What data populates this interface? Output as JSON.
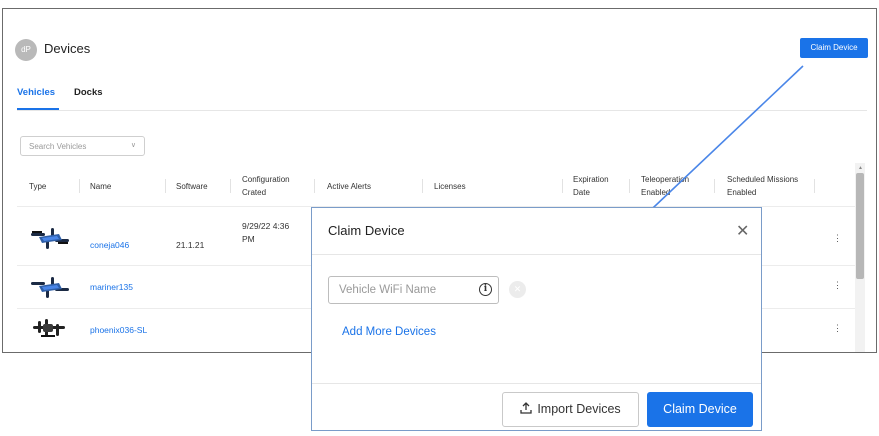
{
  "header": {
    "logo_text": "dP",
    "title": "Devices",
    "claim_button": "Claim Device"
  },
  "tabs": [
    {
      "label": "Vehicles",
      "active": true
    },
    {
      "label": "Docks",
      "active": false
    }
  ],
  "search": {
    "placeholder": "Search Vehicles"
  },
  "table": {
    "columns": {
      "type": "Type",
      "name": "Name",
      "software": "Software",
      "config_line1": "Configuration",
      "config_line2": "Crated",
      "alerts": "Active Alerts",
      "licenses": "Licenses",
      "expiration_line1": "Expiration",
      "expiration_line2": "Date",
      "teleop_line1": "Teleoperation",
      "teleop_line2": "Enabled",
      "scheduled_line1": "Scheduled Missions",
      "scheduled_line2": "Enabled"
    },
    "rows": [
      {
        "name": "coneja046",
        "software": "21.1.21",
        "config_line1": "9/29/22 4:36",
        "config_line2": "PM",
        "icon": "drone-icon"
      },
      {
        "name": "mariner135",
        "software": "",
        "config_line1": "",
        "config_line2": "",
        "icon": "drone-icon"
      },
      {
        "name": "phoenix036-SL",
        "software": "",
        "config_line1": "",
        "config_line2": "",
        "icon": "drone-icon"
      }
    ]
  },
  "modal": {
    "title": "Claim Device",
    "wifi_placeholder": "Vehicle WiFi Name",
    "add_more": "Add More Devices",
    "import_button": "Import Devices",
    "claim_button": "Claim Device"
  },
  "colors": {
    "accent": "#1a73e8",
    "callout_arrow": "#4a86e8"
  }
}
